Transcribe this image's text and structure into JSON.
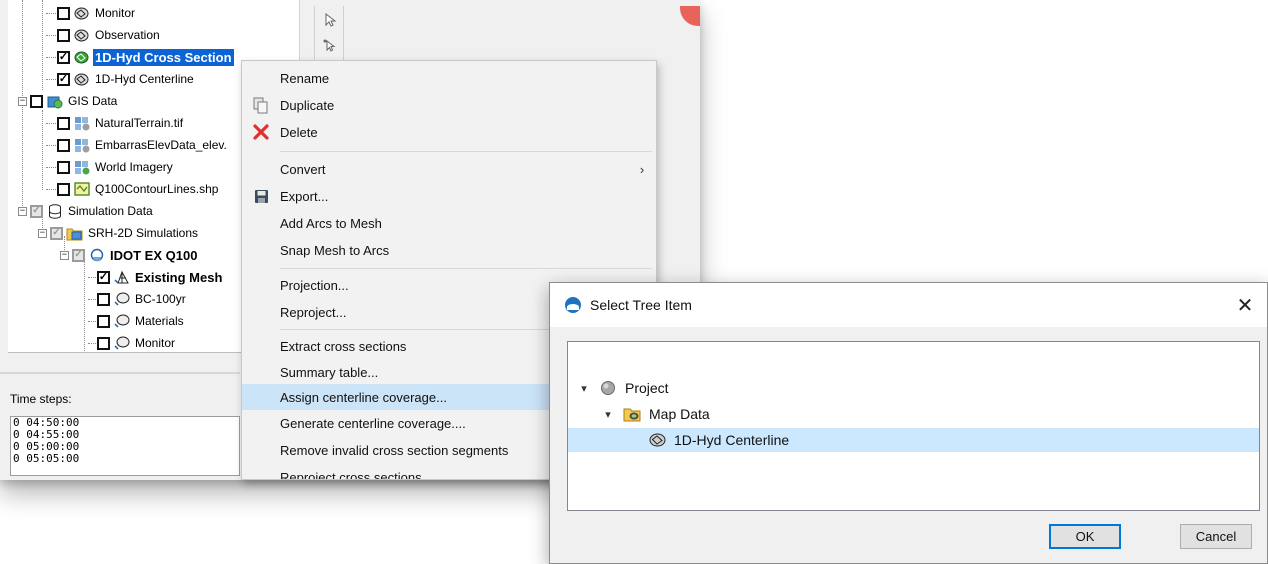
{
  "tree": {
    "rows": [
      {
        "label": "Monitor",
        "checked": false
      },
      {
        "label": "Observation",
        "checked": false
      },
      {
        "label": "1D-Hyd Cross Section",
        "checked": true,
        "selected": true
      },
      {
        "label": "1D-Hyd Centerline",
        "checked": true
      },
      {
        "label": "GIS Data",
        "checked": false
      },
      {
        "label": "NaturalTerrain.tif",
        "checked": false
      },
      {
        "label": "EmbarrasElevData_elev.",
        "checked": false
      },
      {
        "label": "World Imagery",
        "checked": false
      },
      {
        "label": "Q100ContourLines.shp",
        "checked": false
      },
      {
        "label": "Simulation Data",
        "checked": "partial"
      },
      {
        "label": "SRH-2D Simulations",
        "checked": "partial"
      },
      {
        "label": "IDOT EX Q100",
        "checked": "partial",
        "bold": true
      },
      {
        "label": "Existing Mesh",
        "checked": true,
        "bold": true
      },
      {
        "label": "BC-100yr",
        "checked": false
      },
      {
        "label": "Materials",
        "checked": false
      },
      {
        "label": "Monitor",
        "checked": false
      }
    ]
  },
  "time_steps": {
    "label": "Time steps:",
    "values": [
      "0 04:50:00",
      "0 04:55:00",
      "0 05:00:00",
      "0 05:05:00"
    ]
  },
  "context_menu": {
    "items": [
      {
        "label": "Rename",
        "icon": ""
      },
      {
        "label": "Duplicate",
        "icon": "duplicate-icon"
      },
      {
        "label": "Delete",
        "icon": "delete-icon"
      },
      {
        "label": "Convert",
        "icon": "",
        "submenu": true,
        "arrow": "›"
      },
      {
        "label": "Export...",
        "icon": "save-icon"
      },
      {
        "label": "Add Arcs to Mesh",
        "icon": ""
      },
      {
        "label": "Snap Mesh to Arcs",
        "icon": ""
      },
      {
        "label": "Projection...",
        "icon": ""
      },
      {
        "label": "Reproject...",
        "icon": ""
      },
      {
        "label": "Extract cross sections",
        "icon": ""
      },
      {
        "label": "Summary table...",
        "icon": ""
      },
      {
        "label": "Assign centerline coverage...",
        "icon": "",
        "highlighted": true
      },
      {
        "label": "Generate centerline coverage....",
        "icon": ""
      },
      {
        "label": "Remove invalid cross section segments",
        "icon": ""
      },
      {
        "label": "Reproject cross sections",
        "icon": ""
      }
    ]
  },
  "dialog": {
    "title": "Select Tree Item",
    "close": "✕",
    "tree": [
      {
        "label": "Project",
        "chevron": "▾",
        "icon": "project-icon"
      },
      {
        "label": "Map Data",
        "chevron": "▾",
        "icon": "folder-map-icon"
      },
      {
        "label": "1D-Hyd Centerline",
        "icon": "coverage-icon",
        "selected": true
      }
    ],
    "ok_label": "OK",
    "cancel_label": "Cancel"
  },
  "colors": {
    "selection_blue": "#0a64d6",
    "menu_hover": "#cce4f7",
    "dialog_selection": "#cce8ff",
    "default_button_border": "#0078d7",
    "delete_red": "#e03030"
  }
}
